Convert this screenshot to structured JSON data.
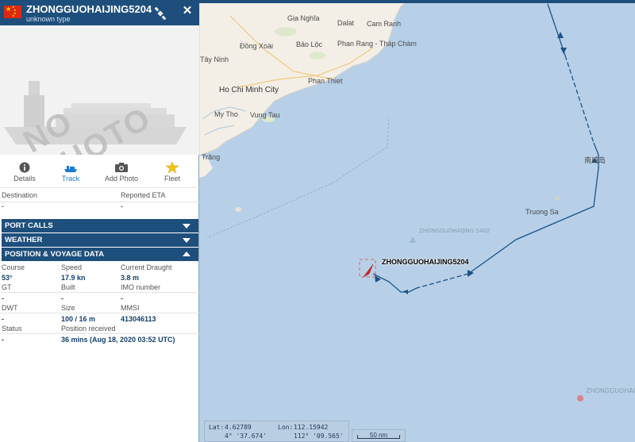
{
  "vessel": {
    "name": "ZHONGGUOHAIJING5204",
    "type": "unknown type",
    "flag_colors": {
      "red": "#de2910",
      "yellow": "#ffde00"
    }
  },
  "photo": {
    "placeholder_text": "NO PHOTO"
  },
  "tabs": [
    {
      "label": "Details",
      "icon": "info-icon"
    },
    {
      "label": "Track",
      "icon": "ship-track-icon",
      "active": true
    },
    {
      "label": "Add Photo",
      "icon": "camera-icon"
    },
    {
      "label": "Fleet",
      "icon": "star-icon"
    }
  ],
  "voyage": {
    "destination_label": "Destination",
    "destination_value": "-",
    "eta_label": "Reported ETA",
    "eta_value": "-"
  },
  "sections": {
    "port_calls": "PORT CALLS",
    "weather": "WEATHER",
    "position_voyage": "POSITION & VOYAGE DATA"
  },
  "position": {
    "course_label": "Course",
    "course_value": "53°",
    "speed_label": "Speed",
    "speed_value": "17.9 kn",
    "draught_label": "Current Draught",
    "draught_value": "3.8 m",
    "gt_label": "GT",
    "gt_value": "-",
    "built_label": "Built",
    "built_value": "-",
    "imo_label": "IMO number",
    "imo_value": "-",
    "dwt_label": "DWT",
    "dwt_value": "-",
    "size_label": "Size",
    "size_value": "100 / 16 m",
    "mmsi_label": "MMSI",
    "mmsi_value": "413046113",
    "status_label": "Status",
    "status_value": "-",
    "received_label": "Position received",
    "received_value": "36 mins (Aug 18, 2020 03:52 UTC)"
  },
  "map": {
    "places": [
      "Gia Nghĩa",
      "Dalat",
      "Cam Ranh",
      "Đồng Xoài",
      "Bảo Lộc",
      "Phan Rang - Tháp Chàm",
      "Tây Ninh",
      "Phan Thiet",
      "Ho Chi Minh City",
      "My Tho",
      "Vung Tau",
      "Trăng",
      "Truong Sa",
      "南威岛"
    ],
    "ship_label": "ZHONGGUOHAIJING5204",
    "ghost_label": "ZHONGGUOHAIJING 5402",
    "ghost_label_2": "ZHONGGUOHAIJIN",
    "coords": {
      "lat_label": "Lat:",
      "lat": "4.62789",
      "lat_dms": "4° '37.674'",
      "lon_label": "Lon:",
      "lon": "112.15942",
      "lon_dms": "112° '09.565'"
    },
    "scale": "50 nm",
    "colors": {
      "sea": "#b7d0e8",
      "land": "#f3efe6",
      "track": "#1c5389",
      "header": "#1e4f7c"
    }
  }
}
